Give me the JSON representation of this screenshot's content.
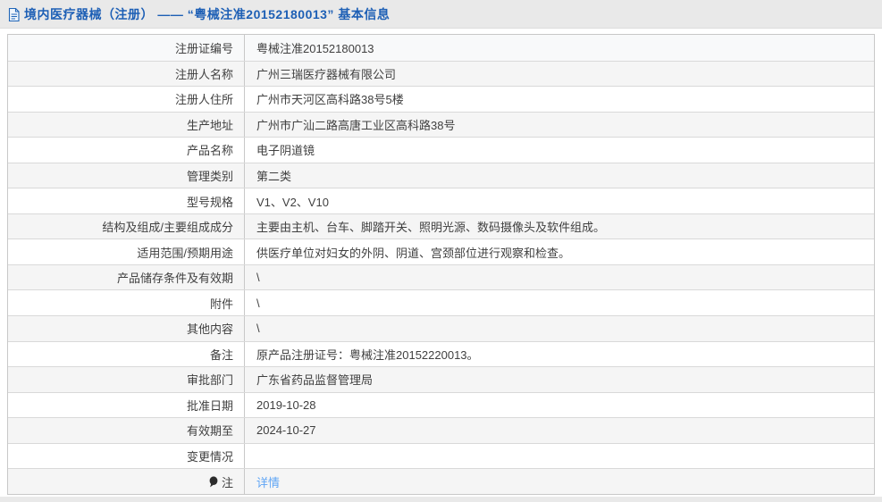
{
  "page": {
    "background_color": "#e9e9e9",
    "accent_blue": "#1d5fb5",
    "link_blue": "#5fa5f5"
  },
  "header": {
    "icon": "document-icon",
    "title": "境内医疗器械（注册） —— “粤械注准20152180013” 基本信息"
  },
  "table": {
    "rows": [
      {
        "label": "注册证编号",
        "value": "粤械注准20152180013"
      },
      {
        "label": "注册人名称",
        "value": "广州三瑞医疗器械有限公司"
      },
      {
        "label": "注册人住所",
        "value": "广州市天河区高科路38号5楼"
      },
      {
        "label": "生产地址",
        "value": "广州市广汕二路高唐工业区高科路38号"
      },
      {
        "label": "产品名称",
        "value": "电子阴道镜"
      },
      {
        "label": "管理类别",
        "value": "第二类"
      },
      {
        "label": "型号规格",
        "value": "V1、V2、V10"
      },
      {
        "label": "结构及组成/主要组成成分",
        "value": "主要由主机、台车、脚踏开关、照明光源、数码摄像头及软件组成。"
      },
      {
        "label": "适用范围/预期用途",
        "value": "供医疗单位对妇女的外阴、阴道、宫颈部位进行观察和检查。"
      },
      {
        "label": "产品储存条件及有效期",
        "value": "\\"
      },
      {
        "label": "附件",
        "value": "\\"
      },
      {
        "label": "其他内容",
        "value": "\\"
      },
      {
        "label": "备注",
        "value": "原产品注册证号：粤械注准20152220013。"
      },
      {
        "label": "审批部门",
        "value": "广东省药品监督管理局"
      },
      {
        "label": "批准日期",
        "value": "2019-10-28"
      },
      {
        "label": "有效期至",
        "value": "2024-10-27"
      },
      {
        "label": "变更情况",
        "value": ""
      },
      {
        "label": "注",
        "label_icon": "comment-balloon-icon",
        "value": "详情",
        "value_is_link": true
      }
    ]
  }
}
